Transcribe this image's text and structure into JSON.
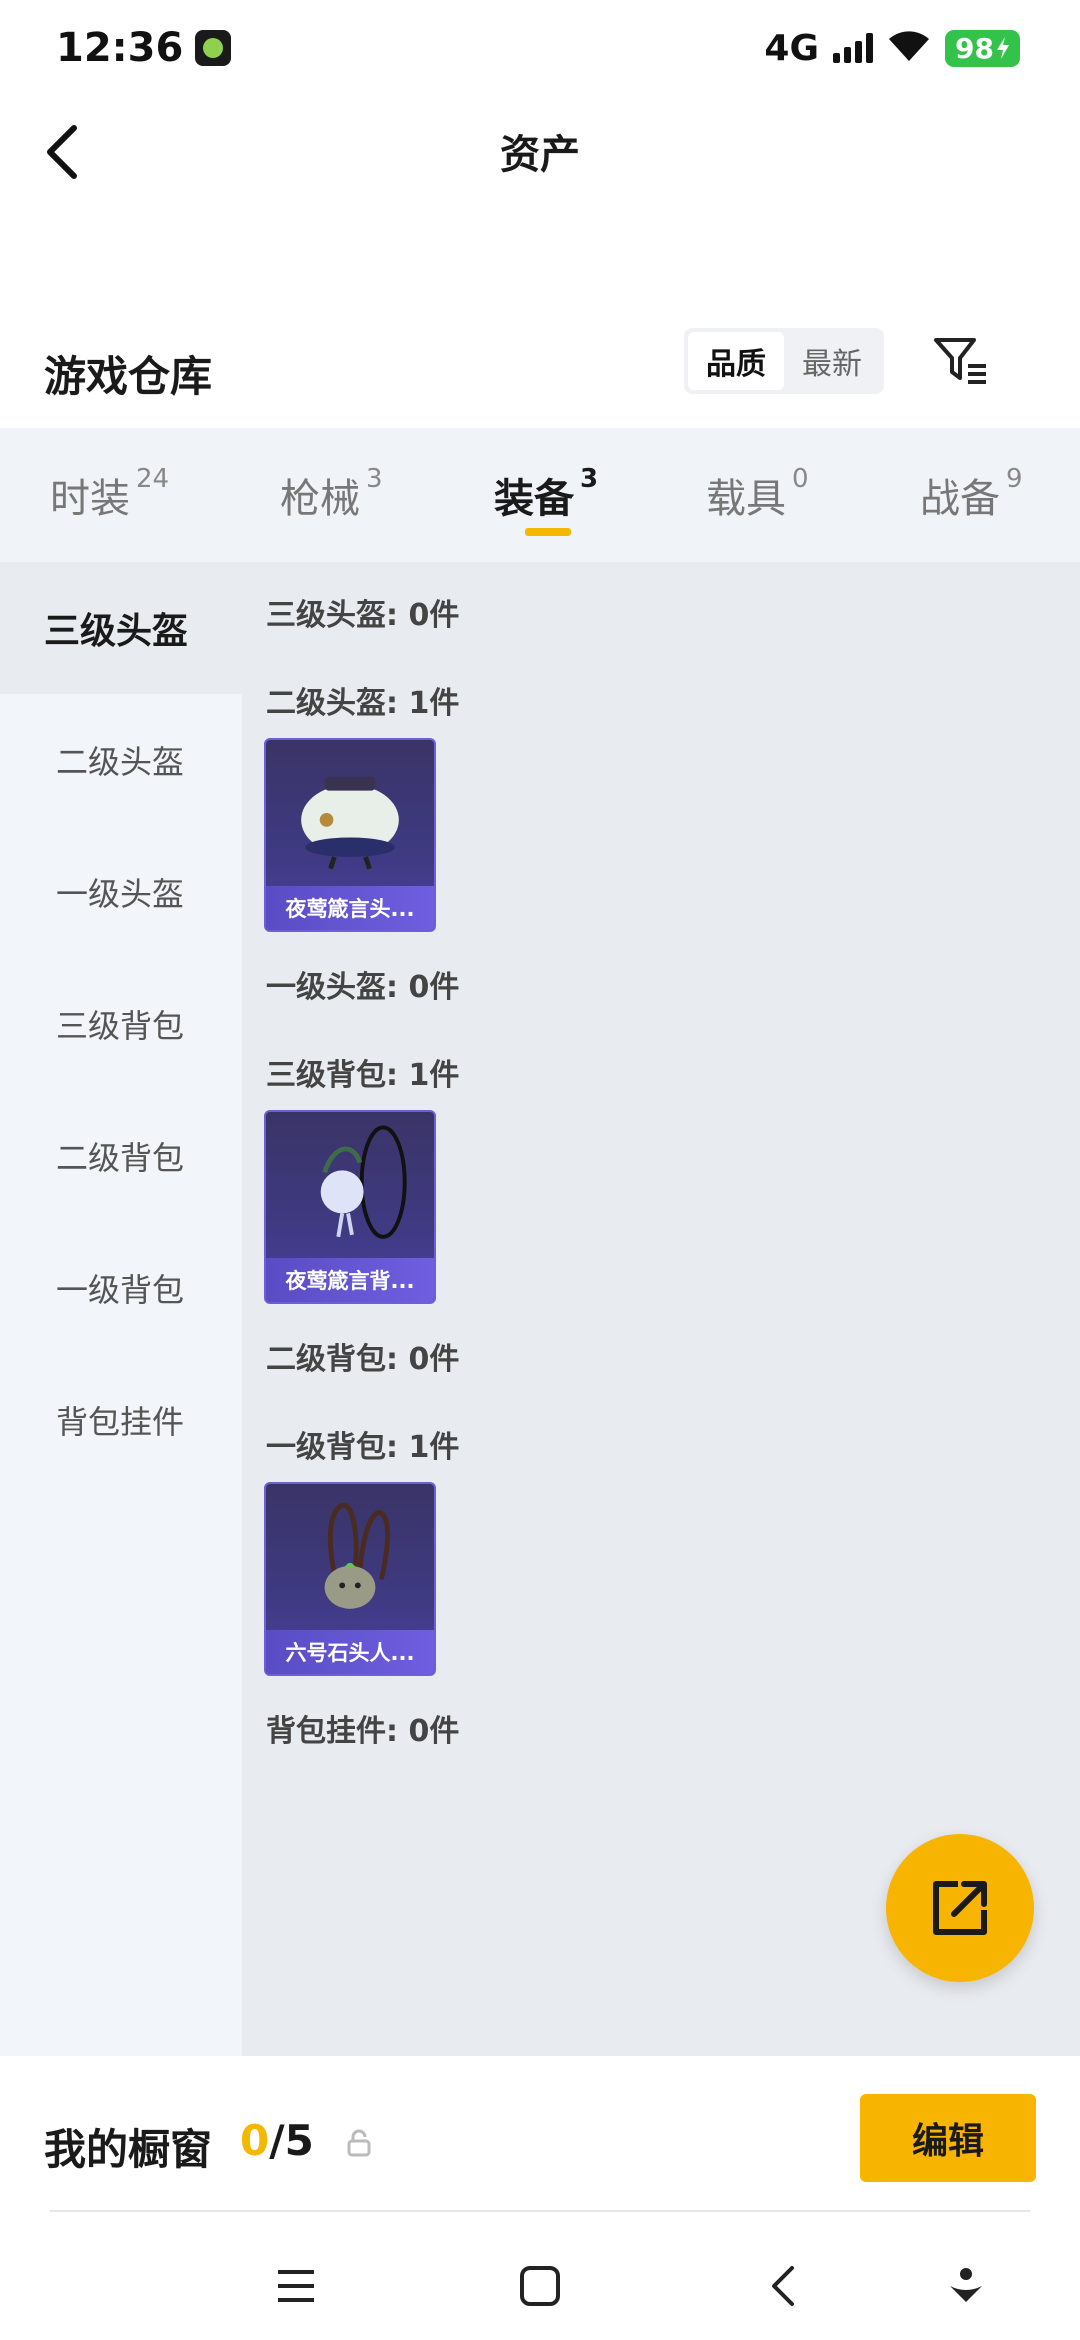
{
  "status_bar": {
    "time": "12:36",
    "network": "4G",
    "battery": "98"
  },
  "header": {
    "title": "资产"
  },
  "warehouse": {
    "title": "游戏仓库",
    "sort_options": [
      "品质",
      "最新"
    ],
    "active_sort": "品质"
  },
  "category_tabs": [
    {
      "label": "时装",
      "count": "24"
    },
    {
      "label": "枪械",
      "count": "3"
    },
    {
      "label": "装备",
      "count": "3"
    },
    {
      "label": "载具",
      "count": "0"
    },
    {
      "label": "战备",
      "count": "9"
    }
  ],
  "active_category": "装备",
  "sidebar": {
    "items": [
      "三级头盔",
      "二级头盔",
      "一级头盔",
      "三级背包",
      "二级背包",
      "一级背包",
      "背包挂件"
    ],
    "active": "三级头盔"
  },
  "sections": [
    {
      "label": "三级头盔: 0件"
    },
    {
      "label": "二级头盔: 1件",
      "item_name": "夜莺箴言头..."
    },
    {
      "label": "一级头盔: 0件"
    },
    {
      "label": "三级背包: 1件",
      "item_name": "夜莺箴言背..."
    },
    {
      "label": "二级背包: 0件"
    },
    {
      "label": "一级背包: 1件",
      "item_name": "六号石头人..."
    },
    {
      "label": "背包挂件: 0件"
    }
  ],
  "showcase": {
    "title": "我的橱窗",
    "current": "0",
    "total": "/5",
    "edit_label": "编辑"
  },
  "colors": {
    "accent": "#f7b400",
    "item_card": "#3f3a82",
    "tabs_bg": "#f0f3f7",
    "content_bg": "#e8ebef"
  }
}
